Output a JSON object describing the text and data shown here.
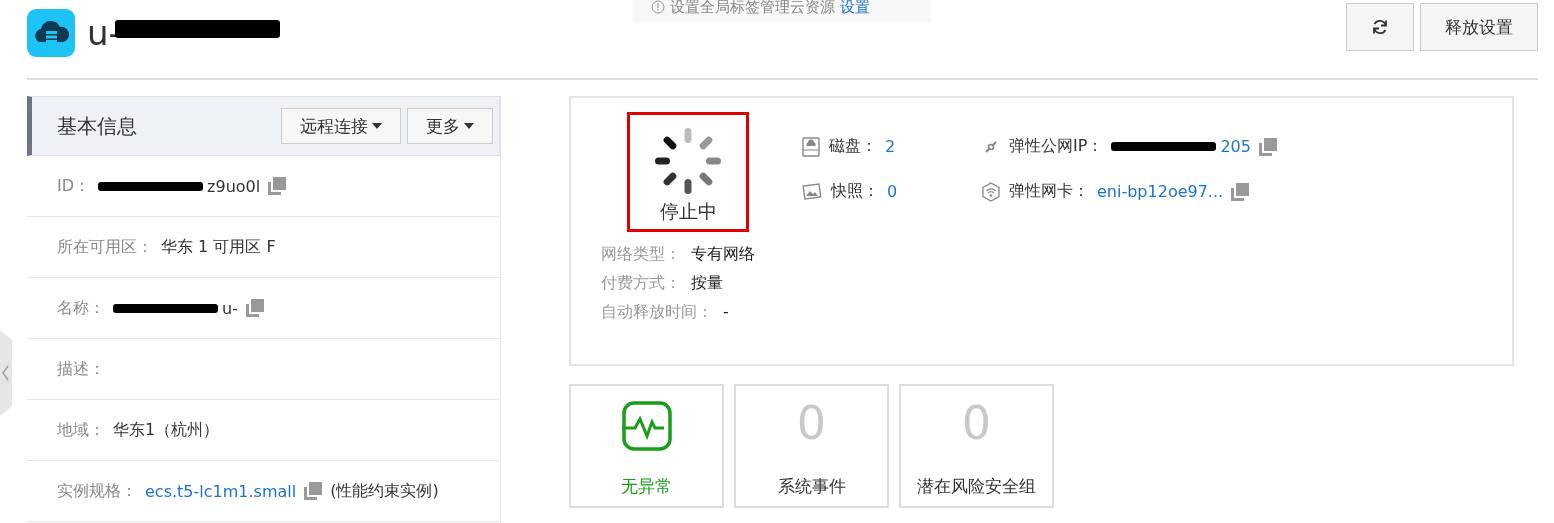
{
  "banner": {
    "text": "设置全局标签管理云资源",
    "link": "设置"
  },
  "header": {
    "title": "u-",
    "redacted": true,
    "buttons": [
      {
        "kind": "refresh"
      },
      {
        "kind": "text",
        "label": "释放设置"
      }
    ]
  },
  "info_panel": {
    "title": "基本信息",
    "buttons": [
      "远程连接",
      "更多"
    ],
    "rows": [
      {
        "label": "ID：",
        "value": "z9uo0l",
        "redacted": true,
        "link": false,
        "copy": true
      },
      {
        "label": "所在可用区：",
        "value": "华东 1 可用区 F",
        "redacted": false,
        "link": false,
        "copy": false
      },
      {
        "label": "名称：",
        "value": "u-",
        "redacted": true,
        "link": false,
        "copy": true
      },
      {
        "label": "描述：",
        "redacted": false,
        "link": false,
        "copy": false
      },
      {
        "label": "地域：",
        "value": "华东1（杭州）",
        "redacted": false,
        "link": false,
        "copy": false
      },
      {
        "label": "实例规格：",
        "value": "ecs.t5-lc1m1.small",
        "note": "(性能约束实例)",
        "redacted": false,
        "link": true,
        "copy": true
      }
    ]
  },
  "status": {
    "text": "停止中",
    "highlighted": true
  },
  "resources": [
    {
      "kind": "disk",
      "label": "磁盘：",
      "value": "2",
      "redacted": false,
      "copy": false
    },
    {
      "kind": "ip",
      "label": "弹性公网IP：",
      "value": "205",
      "redacted": true,
      "copy": true
    },
    {
      "kind": "snapshot",
      "label": "快照：",
      "value": "0",
      "redacted": false,
      "copy": false
    },
    {
      "kind": "nic",
      "label": "弹性网卡：",
      "value": "eni-bp12oe97...",
      "redacted": false,
      "copy": true
    }
  ],
  "details": [
    {
      "label": "网络类型：",
      "value": "专有网络"
    },
    {
      "label": "付费方式：",
      "value": "按量"
    },
    {
      "label": "自动释放时间：",
      "value": "-"
    }
  ],
  "cards": [
    {
      "kind": "health",
      "label": "无异常"
    },
    {
      "kind": "count",
      "value": "0",
      "label": "系统事件"
    },
    {
      "kind": "count",
      "value": "0",
      "label": "潜在风险安全组"
    }
  ]
}
